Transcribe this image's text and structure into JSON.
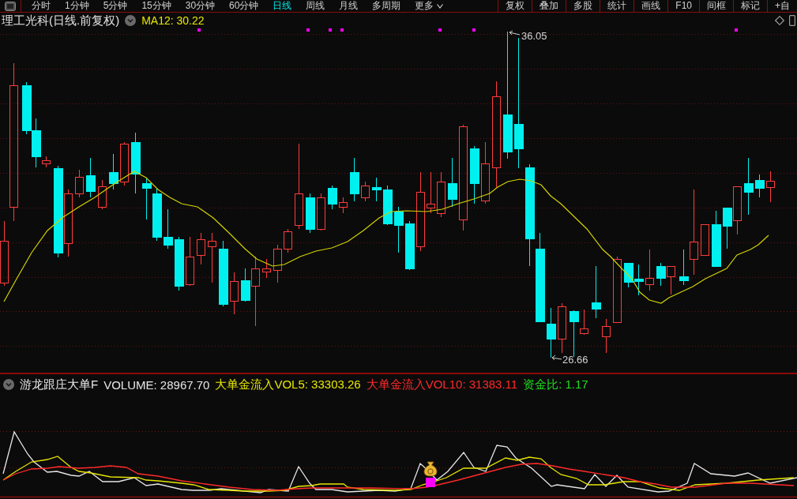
{
  "toolbar": {
    "periods": [
      {
        "label": "分时",
        "selected": false
      },
      {
        "label": "1分钟",
        "selected": false
      },
      {
        "label": "5分钟",
        "selected": false
      },
      {
        "label": "15分钟",
        "selected": false
      },
      {
        "label": "30分钟",
        "selected": false
      },
      {
        "label": "60分钟",
        "selected": false
      },
      {
        "label": "日线",
        "selected": true
      },
      {
        "label": "周线",
        "selected": false
      },
      {
        "label": "月线",
        "selected": false
      },
      {
        "label": "多周期",
        "selected": false
      }
    ],
    "more": "更多",
    "buttons": [
      "复权",
      "叠加",
      "多股",
      "统计",
      "画线",
      "F10",
      "间框",
      "标记",
      "+自"
    ]
  },
  "price_panel": {
    "title": "理工光科(日线.前复权)",
    "ma_reading": "MA12: 30.22",
    "high_label": "36.05",
    "low_label": "26.66"
  },
  "indicator_panel": {
    "name": "游龙跟庄大单F",
    "readings": [
      {
        "text": "VOLUME: 28967.70",
        "color": "#e6e6e6"
      },
      {
        "text": "大单金流入VOL5: 33303.26",
        "color": "#e6e600"
      },
      {
        "text": "大单金流入VOL10: 31383.11",
        "color": "#ff2a2a"
      },
      {
        "text": "资金比: 1.17",
        "color": "#22dd22"
      }
    ]
  }
}
